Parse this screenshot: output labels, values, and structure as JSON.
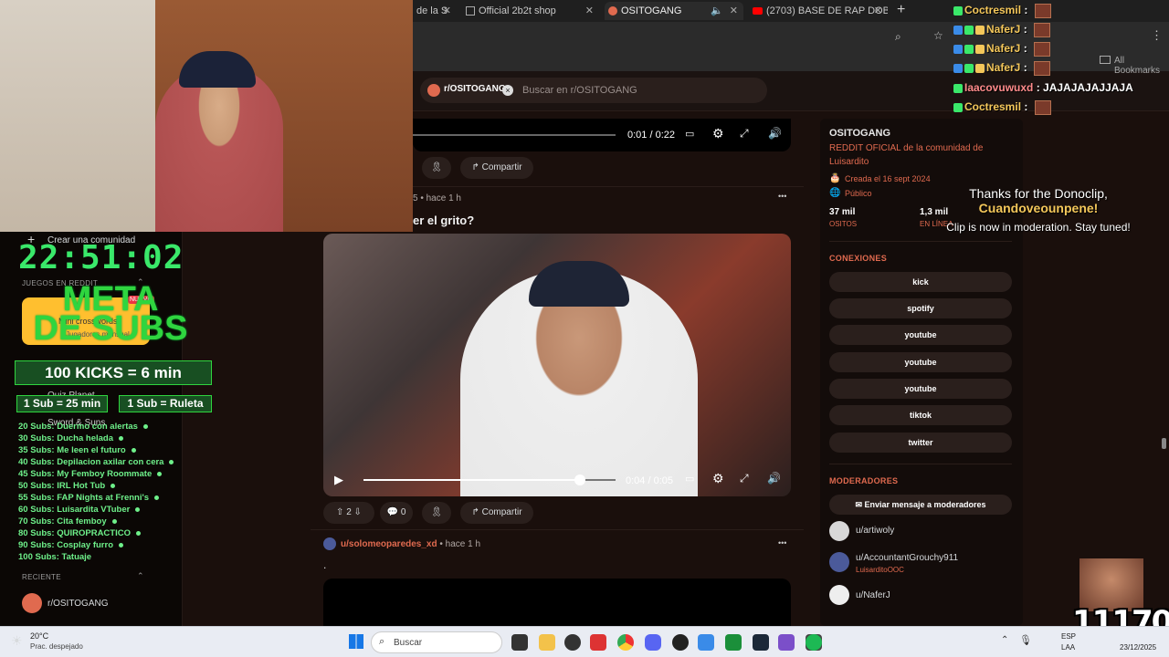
{
  "browser": {
    "tabs": [
      {
        "label": "de la S",
        "active": false
      },
      {
        "label": "Official 2b2t shop",
        "active": false
      },
      {
        "label": "OSITOGANG",
        "active": true
      },
      {
        "label": "(2703) BASE DE RAP DOBLE",
        "active": false
      }
    ],
    "new_tab": "+",
    "bookmarks_label": "All Bookmarks"
  },
  "reddit": {
    "community_chip": "r/OSITOGANG",
    "search_placeholder": "Buscar en r/OSITOGANG",
    "top_video_time": "0:01 / 0:22",
    "share_label": "Compartir",
    "post1": {
      "meta_user": "5",
      "meta_time": "hace 1 h",
      "title": "er el grito?",
      "video_time": "0:04 / 0:05",
      "video_progress": 0.86,
      "votes": "2",
      "comments": "0",
      "share": "Compartir"
    },
    "post2": {
      "user": "u/solomeoparedes_xd",
      "time": "hace 1 h",
      "body": "."
    },
    "more": "•••"
  },
  "sidebar": {
    "name": "OSITOGANG",
    "description": "REDDIT OFICIAL de la comunidad de Luisardito",
    "created": "Creada el 16 sept 2024",
    "visibility": "Público",
    "members_value": "37 mil",
    "members_label": "OSITOS",
    "online_value": "1,3 mil",
    "online_label": "EN LÍNEA",
    "connections_header": "CONEXIONES",
    "links": [
      "kick",
      "spotify",
      "youtube",
      "youtube",
      "youtube",
      "tiktok",
      "twitter"
    ],
    "moderators_header": "MODERADORES",
    "message_mods": "Enviar mensaje a moderadores",
    "moderators": [
      {
        "name": "u/artiwoly",
        "flair": ""
      },
      {
        "name": "u/AccountantGrouchy911",
        "flair": "LuisarditoOOC"
      },
      {
        "name": "u/NaferJ",
        "flair": ""
      }
    ]
  },
  "leftnav": {
    "create_community": "Crear una comunidad",
    "games_header": "JUEGOS EN REDDIT",
    "game1_title": "Mini crosswords",
    "game1_sub": "Jugadores mensual",
    "game2": "Quiz Planet",
    "game3": "Sword & Suns",
    "recent_header": "RECIENTE",
    "recent_item": "r/OSITOGANG",
    "new_badge": "NUEVO"
  },
  "stream_overlay": {
    "clock": "22:51:02",
    "meta_line1": "META",
    "meta_line2": "DE SUBS",
    "kicks": "100 KICKS = 6 min",
    "sub_time": "1 Sub = 25 min",
    "sub_ruleta": "1 Sub = Ruleta",
    "goals": [
      "20 Subs: Duermo con alertas",
      "30 Subs: Ducha helada",
      "35 Subs: Me leen el futuro",
      "40 Subs: Depilacion axilar con cera",
      "45 Subs: My Femboy Roommate",
      "50 Subs: IRL Hot Tub",
      "55 Subs: FAP Nights at Frenni's",
      "60 Subs: Luisardita VTuber",
      "70 Subs: Cita femboy",
      "80 Subs: QUIROPRACTICO",
      "90 Subs: Cosplay furro",
      "100 Subs: Tatuaje"
    ],
    "donoclip_line1": "Thanks for the Donoclip,",
    "donoclip_user": "Cuandoveounpene!",
    "donoclip_line3": "Clip is now in moderation. Stay tuned!",
    "sub_count": "11170"
  },
  "chat": [
    {
      "user": "Coctresmil",
      "msg": ""
    },
    {
      "user": "NaferJ",
      "msg": ""
    },
    {
      "user": "NaferJ",
      "msg": ""
    },
    {
      "user": "NaferJ",
      "msg": ""
    },
    {
      "user": "Iaacovuwuxd",
      "msg": "JAJAJAJAJJAJA"
    },
    {
      "user": "Coctresmil",
      "msg": ""
    }
  ],
  "taskbar": {
    "weather_temp": "20°C",
    "weather_desc": "Prac. despejado",
    "search_label": "Buscar",
    "lang1": "ESP",
    "lang2": "LAA",
    "date": "23/12/2025"
  },
  "colors": {
    "reddit_orange": "#e06a4f",
    "overlay_green": "#2fd53f",
    "chat_name": "#f4c75a"
  }
}
